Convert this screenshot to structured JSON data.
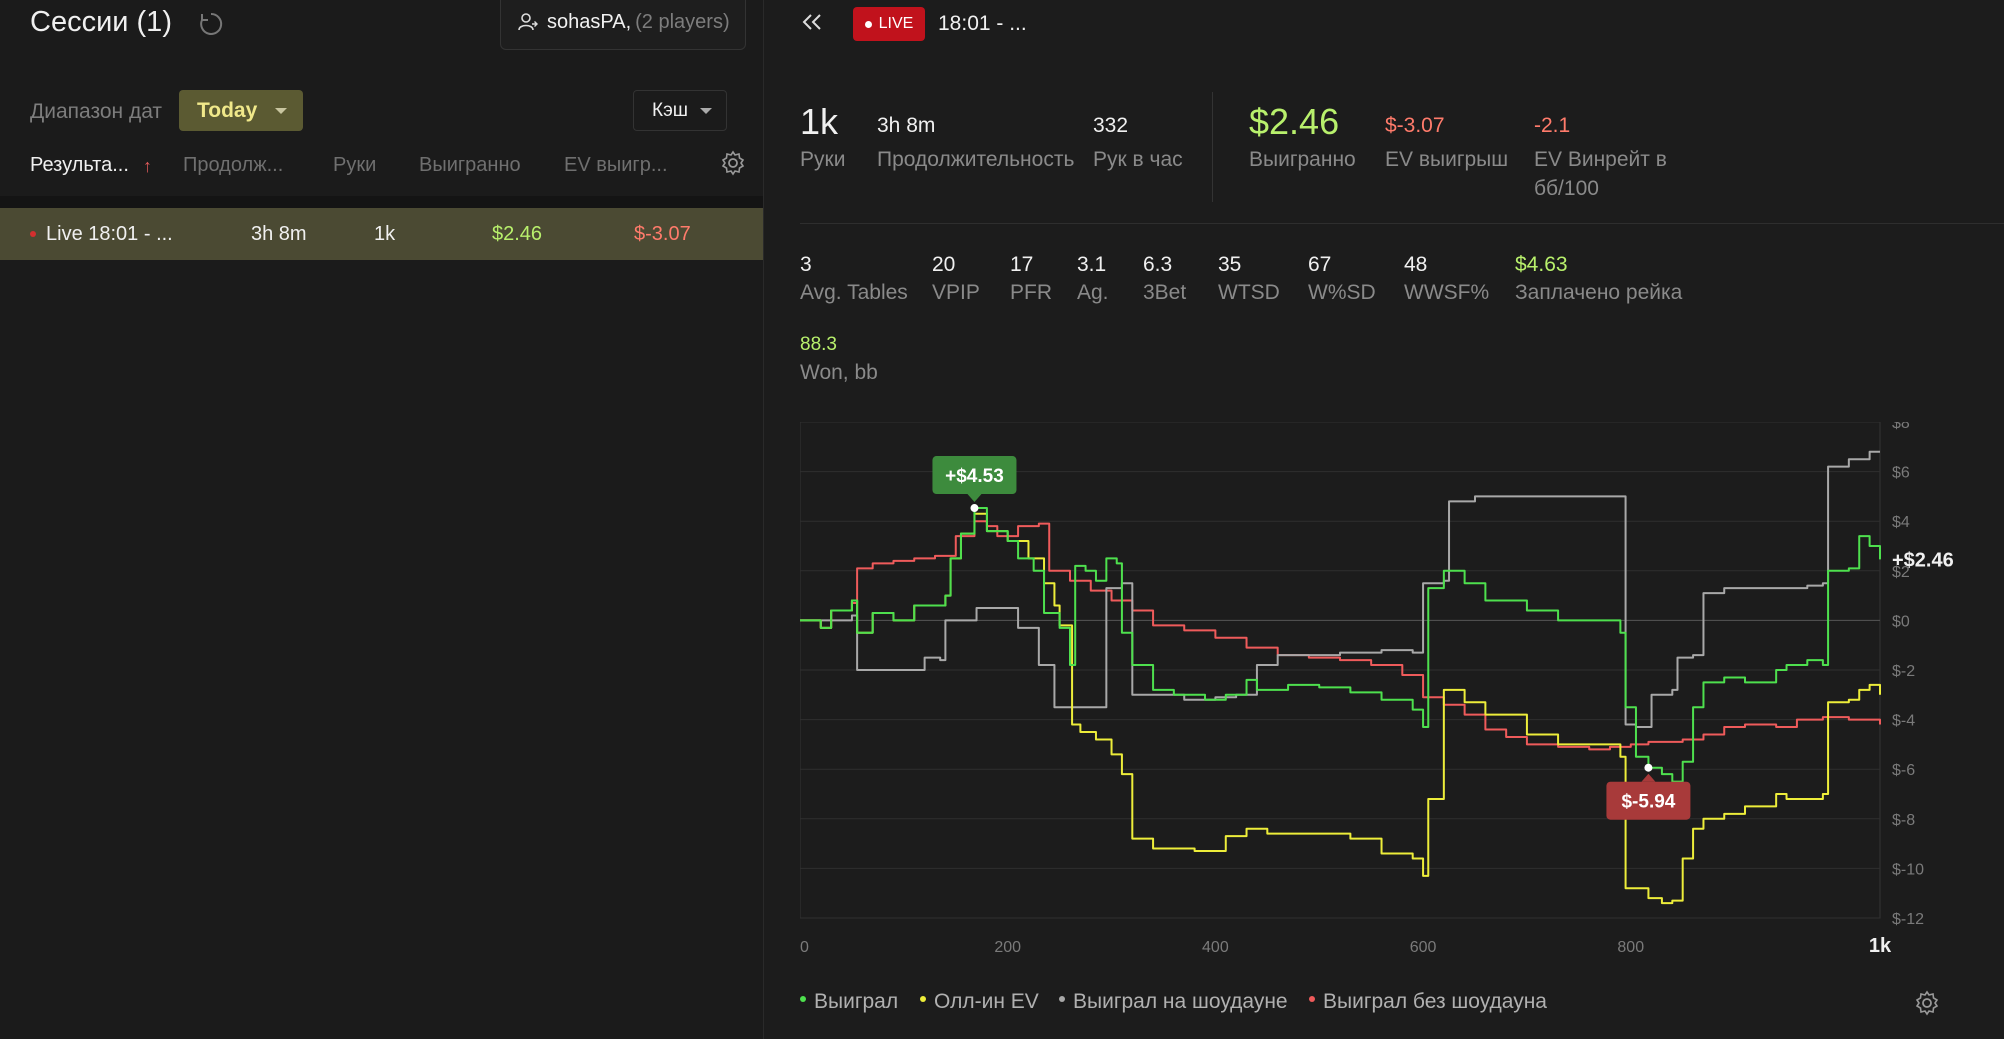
{
  "left": {
    "title": "Сессии (1)",
    "player_filter": {
      "name": "sohasPA,",
      "count": "(2 players)"
    },
    "date_range_label": "Диапазон дат",
    "date_range_value": "Today",
    "game_type": "Кэш",
    "columns": [
      "Результа...",
      "Продолж...",
      "Руки",
      "Выигранно",
      "EV выигр..."
    ],
    "rows": [
      {
        "name": "Live 18:01 - ...",
        "duration": "3h 8m",
        "hands": "1k",
        "won": "$2.46",
        "ev_won": "$-3.07"
      }
    ]
  },
  "right": {
    "live_badge": "LIVE",
    "session_title": "18:01 - ...",
    "summary": {
      "hands": {
        "value": "1k",
        "label": "Руки"
      },
      "duration": {
        "value": "3h 8m",
        "label": "Продолжительность"
      },
      "hands_per_hour": {
        "value": "332",
        "label": "Рук в час"
      },
      "won": {
        "value": "$2.46",
        "label": "Выигранно"
      },
      "ev_won": {
        "value": "$-3.07",
        "label": "EV выигрыш"
      },
      "ev_winrate": {
        "value": "-2.1",
        "label": "EV Винрейт в бб/100"
      }
    },
    "stats": [
      {
        "value": "3",
        "label": "Avg. Tables"
      },
      {
        "value": "20",
        "label": "VPIP"
      },
      {
        "value": "17",
        "label": "PFR"
      },
      {
        "value": "3.1",
        "label": "Ag."
      },
      {
        "value": "6.3",
        "label": "3Bet"
      },
      {
        "value": "35",
        "label": "WTSD"
      },
      {
        "value": "67",
        "label": "W%SD"
      },
      {
        "value": "48",
        "label": "WWSF%"
      },
      {
        "value": "$4.63",
        "label": "Заплачено рейка"
      }
    ],
    "won_bb": {
      "value": "88.3",
      "label": "Won, bb"
    },
    "legend": [
      "Выиграл",
      "Олл-ин EV",
      "Выиграл на шоудауне",
      "Выиграл без шоудауна"
    ]
  },
  "colors": {
    "won": "#4ee04e",
    "allin_ev": "#eded3a",
    "showdown": "#a8a8a8",
    "non_showdown": "#ef5b5b",
    "accent_green": "#b8f06c",
    "accent_red": "#ff7b6b"
  },
  "chart_data": {
    "type": "line",
    "x_ticks": [
      "0",
      "200",
      "400",
      "600",
      "800",
      "1k"
    ],
    "y_ticks": [
      "$8",
      "$6",
      "$4",
      "$2",
      "$0",
      "$-2",
      "$-4",
      "$-6",
      "$-8",
      "$-10",
      "$-12"
    ],
    "xlim": [
      0,
      1040
    ],
    "ylim": [
      -12,
      8
    ],
    "max_annotation": {
      "x": 168,
      "y": 4.53,
      "label": "+$4.53"
    },
    "min_annotation": {
      "x": 817,
      "y": -5.94,
      "label": "$-5.94"
    },
    "end_label": "+$2.46",
    "series": [
      {
        "name": "Выиграл",
        "color": "#4ee04e",
        "points": [
          [
            0,
            0
          ],
          [
            20,
            -0.3
          ],
          [
            30,
            0.4
          ],
          [
            50,
            0.8
          ],
          [
            55,
            -0.5
          ],
          [
            70,
            0.3
          ],
          [
            90,
            0
          ],
          [
            110,
            0.6
          ],
          [
            140,
            1
          ],
          [
            145,
            2.5
          ],
          [
            155,
            3.5
          ],
          [
            168,
            4.53
          ],
          [
            180,
            3.6
          ],
          [
            200,
            3.2
          ],
          [
            210,
            2.5
          ],
          [
            225,
            2
          ],
          [
            235,
            0.3
          ],
          [
            250,
            -0.3
          ],
          [
            260,
            -1.8
          ],
          [
            265,
            2.2
          ],
          [
            275,
            2
          ],
          [
            285,
            1.6
          ],
          [
            295,
            2.5
          ],
          [
            305,
            2.3
          ],
          [
            310,
            -0.5
          ],
          [
            320,
            -1.8
          ],
          [
            340,
            -2.8
          ],
          [
            360,
            -3
          ],
          [
            390,
            -3.2
          ],
          [
            410,
            -3
          ],
          [
            430,
            -2.4
          ],
          [
            440,
            -2.8
          ],
          [
            470,
            -2.6
          ],
          [
            500,
            -2.7
          ],
          [
            530,
            -2.9
          ],
          [
            560,
            -3.2
          ],
          [
            590,
            -3.6
          ],
          [
            600,
            -4.3
          ],
          [
            605,
            1.3
          ],
          [
            620,
            2
          ],
          [
            640,
            1.5
          ],
          [
            660,
            0.8
          ],
          [
            700,
            0.4
          ],
          [
            730,
            0
          ],
          [
            790,
            -0.5
          ],
          [
            795,
            -3.5
          ],
          [
            805,
            -5.5
          ],
          [
            817,
            -5.94
          ],
          [
            830,
            -6.2
          ],
          [
            840,
            -6.5
          ],
          [
            850,
            -5.7
          ],
          [
            860,
            -3.5
          ],
          [
            870,
            -2.5
          ],
          [
            890,
            -2.3
          ],
          [
            910,
            -2.5
          ],
          [
            940,
            -2.0
          ],
          [
            950,
            -1.8
          ],
          [
            970,
            -1.6
          ],
          [
            985,
            -1.8
          ],
          [
            990,
            2
          ],
          [
            1010,
            2.1
          ],
          [
            1020,
            3.4
          ],
          [
            1030,
            3
          ],
          [
            1040,
            2.46
          ]
        ]
      },
      {
        "name": "Олл-ин EV",
        "color": "#eded3a",
        "points": [
          [
            0,
            0
          ],
          [
            20,
            -0.3
          ],
          [
            30,
            0.4
          ],
          [
            50,
            0.8
          ],
          [
            55,
            -0.5
          ],
          [
            70,
            0.3
          ],
          [
            90,
            0
          ],
          [
            110,
            0.6
          ],
          [
            140,
            1
          ],
          [
            145,
            2.5
          ],
          [
            155,
            3.5
          ],
          [
            168,
            4.3
          ],
          [
            180,
            3.6
          ],
          [
            200,
            3.2
          ],
          [
            220,
            2.5
          ],
          [
            235,
            1.5
          ],
          [
            245,
            0.6
          ],
          [
            250,
            -0.2
          ],
          [
            262,
            -4.2
          ],
          [
            270,
            -4.5
          ],
          [
            285,
            -4.8
          ],
          [
            300,
            -5.4
          ],
          [
            310,
            -6.2
          ],
          [
            320,
            -8.8
          ],
          [
            340,
            -9.2
          ],
          [
            380,
            -9.3
          ],
          [
            410,
            -8.7
          ],
          [
            430,
            -8.4
          ],
          [
            450,
            -8.6
          ],
          [
            500,
            -8.6
          ],
          [
            530,
            -8.8
          ],
          [
            560,
            -9.4
          ],
          [
            590,
            -9.6
          ],
          [
            600,
            -10.3
          ],
          [
            605,
            -7.2
          ],
          [
            620,
            -2.8
          ],
          [
            640,
            -3.3
          ],
          [
            660,
            -3.8
          ],
          [
            700,
            -4.6
          ],
          [
            730,
            -5
          ],
          [
            790,
            -5.5
          ],
          [
            795,
            -10.8
          ],
          [
            817,
            -11.2
          ],
          [
            830,
            -11.4
          ],
          [
            840,
            -11.3
          ],
          [
            850,
            -9.6
          ],
          [
            860,
            -8.4
          ],
          [
            870,
            -8
          ],
          [
            890,
            -7.8
          ],
          [
            910,
            -7.5
          ],
          [
            940,
            -7
          ],
          [
            950,
            -7.2
          ],
          [
            960,
            -7.2
          ],
          [
            985,
            -7
          ],
          [
            990,
            -3.3
          ],
          [
            1010,
            -3.2
          ],
          [
            1020,
            -2.8
          ],
          [
            1030,
            -2.6
          ],
          [
            1040,
            -3
          ]
        ]
      },
      {
        "name": "Выиграл на шоудауне",
        "color": "#a8a8a8",
        "points": [
          [
            0,
            0
          ],
          [
            20,
            0
          ],
          [
            50,
            0.2
          ],
          [
            55,
            -2
          ],
          [
            100,
            -2
          ],
          [
            120,
            -1.5
          ],
          [
            135,
            -1.6
          ],
          [
            140,
            0
          ],
          [
            170,
            0.5
          ],
          [
            200,
            0.5
          ],
          [
            210,
            -0.3
          ],
          [
            230,
            -1.8
          ],
          [
            245,
            -3.5
          ],
          [
            280,
            -3.5
          ],
          [
            295,
            1.3
          ],
          [
            310,
            1.5
          ],
          [
            320,
            -3
          ],
          [
            350,
            -3
          ],
          [
            370,
            -3.2
          ],
          [
            400,
            -3.1
          ],
          [
            420,
            -3
          ],
          [
            440,
            -1.8
          ],
          [
            460,
            -1.4
          ],
          [
            500,
            -1.4
          ],
          [
            520,
            -1.3
          ],
          [
            560,
            -1.2
          ],
          [
            590,
            -1.3
          ],
          [
            600,
            1.5
          ],
          [
            620,
            1.6
          ],
          [
            625,
            4.8
          ],
          [
            650,
            5
          ],
          [
            790,
            5
          ],
          [
            795,
            -4.2
          ],
          [
            805,
            -4.3
          ],
          [
            820,
            -3
          ],
          [
            840,
            -2.8
          ],
          [
            845,
            -1.5
          ],
          [
            860,
            -1.4
          ],
          [
            870,
            1.1
          ],
          [
            890,
            1.3
          ],
          [
            970,
            1.4
          ],
          [
            985,
            1.5
          ],
          [
            990,
            6.2
          ],
          [
            1010,
            6.5
          ],
          [
            1030,
            6.8
          ],
          [
            1040,
            6.8
          ]
        ]
      },
      {
        "name": "Выиграл без шоудауна",
        "color": "#ef5b5b",
        "points": [
          [
            0,
            0
          ],
          [
            20,
            -0.3
          ],
          [
            30,
            0.4
          ],
          [
            50,
            0.7
          ],
          [
            55,
            2.1
          ],
          [
            70,
            2.3
          ],
          [
            90,
            2.4
          ],
          [
            110,
            2.5
          ],
          [
            130,
            2.6
          ],
          [
            150,
            3.4
          ],
          [
            168,
            4.0
          ],
          [
            180,
            3.8
          ],
          [
            190,
            3.4
          ],
          [
            210,
            3.8
          ],
          [
            230,
            3.9
          ],
          [
            240,
            2
          ],
          [
            260,
            1.6
          ],
          [
            280,
            1.2
          ],
          [
            300,
            0.8
          ],
          [
            320,
            0.4
          ],
          [
            340,
            -0.2
          ],
          [
            370,
            -0.4
          ],
          [
            400,
            -0.7
          ],
          [
            430,
            -1.1
          ],
          [
            460,
            -1.4
          ],
          [
            490,
            -1.5
          ],
          [
            520,
            -1.6
          ],
          [
            550,
            -1.8
          ],
          [
            580,
            -2.2
          ],
          [
            600,
            -3.1
          ],
          [
            620,
            -3.4
          ],
          [
            640,
            -3.8
          ],
          [
            660,
            -4.4
          ],
          [
            680,
            -4.7
          ],
          [
            700,
            -5
          ],
          [
            730,
            -5.1
          ],
          [
            760,
            -5.2
          ],
          [
            780,
            -5.1
          ],
          [
            800,
            -5.0
          ],
          [
            817,
            -4.9
          ],
          [
            830,
            -4.9
          ],
          [
            850,
            -4.8
          ],
          [
            870,
            -4.6
          ],
          [
            890,
            -4.3
          ],
          [
            910,
            -4.2
          ],
          [
            940,
            -4.3
          ],
          [
            960,
            -4
          ],
          [
            985,
            -3.9
          ],
          [
            1010,
            -4
          ],
          [
            1040,
            -4.2
          ]
        ]
      }
    ]
  }
}
